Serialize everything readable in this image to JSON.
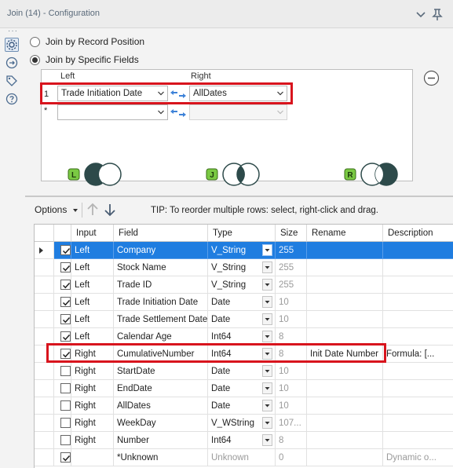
{
  "title": "Join (14) - Configuration",
  "join_options": {
    "by_position": "Join by Record Position",
    "by_fields": "Join by Specific Fields"
  },
  "join_fields": {
    "left_header": "Left",
    "right_header": "Right",
    "rows": [
      {
        "num": "1",
        "left": "Trade Initiation Date",
        "right": "AllDates"
      },
      {
        "num": "*",
        "left": "",
        "right": ""
      }
    ]
  },
  "venn": {
    "left_label": "L",
    "join_label": "J",
    "right_label": "R"
  },
  "toolbar": {
    "options_label": "Options",
    "tip": "TIP: To reorder multiple rows: select, right-click and drag."
  },
  "table": {
    "headers": [
      "Input",
      "Field",
      "Type",
      "Size",
      "Rename",
      "Description"
    ],
    "rows": [
      {
        "checked": true,
        "input": "Left",
        "field": "Company",
        "type": "V_String",
        "size": "255",
        "rename": "",
        "description": "",
        "selected": true
      },
      {
        "checked": true,
        "input": "Left",
        "field": "Stock Name",
        "type": "V_String",
        "size": "255",
        "rename": "",
        "description": ""
      },
      {
        "checked": true,
        "input": "Left",
        "field": "Trade ID",
        "type": "V_String",
        "size": "255",
        "rename": "",
        "description": ""
      },
      {
        "checked": true,
        "input": "Left",
        "field": "Trade Initiation Date",
        "type": "Date",
        "size": "10",
        "rename": "",
        "description": ""
      },
      {
        "checked": true,
        "input": "Left",
        "field": "Trade Settlement Date",
        "type": "Date",
        "size": "10",
        "rename": "",
        "description": ""
      },
      {
        "checked": true,
        "input": "Left",
        "field": "Calendar Age",
        "type": "Int64",
        "size": "8",
        "rename": "",
        "description": ""
      },
      {
        "checked": true,
        "input": "Right",
        "field": "CumulativeNumber",
        "type": "Int64",
        "size": "8",
        "rename": "Init Date Number",
        "description": "Formula: [..."
      },
      {
        "checked": false,
        "input": "Right",
        "field": "StartDate",
        "type": "Date",
        "size": "10",
        "rename": "",
        "description": ""
      },
      {
        "checked": false,
        "input": "Right",
        "field": "EndDate",
        "type": "Date",
        "size": "10",
        "rename": "",
        "description": ""
      },
      {
        "checked": false,
        "input": "Right",
        "field": "AllDates",
        "type": "Date",
        "size": "10",
        "rename": "",
        "description": ""
      },
      {
        "checked": false,
        "input": "Right",
        "field": "WeekDay",
        "type": "V_WString",
        "size": "107...",
        "rename": "",
        "description": ""
      },
      {
        "checked": false,
        "input": "Right",
        "field": "Number",
        "type": "Int64",
        "size": "8",
        "rename": "",
        "description": ""
      },
      {
        "checked": true,
        "input": "",
        "field": "*Unknown",
        "type": "Unknown",
        "size": "0",
        "rename": "",
        "description": "Dynamic o..."
      }
    ]
  },
  "colors": {
    "highlight": "#d8141d",
    "selected_row": "#1f7de0",
    "venn_fill": "#2d4a4a",
    "label_green": "#7ac943"
  }
}
